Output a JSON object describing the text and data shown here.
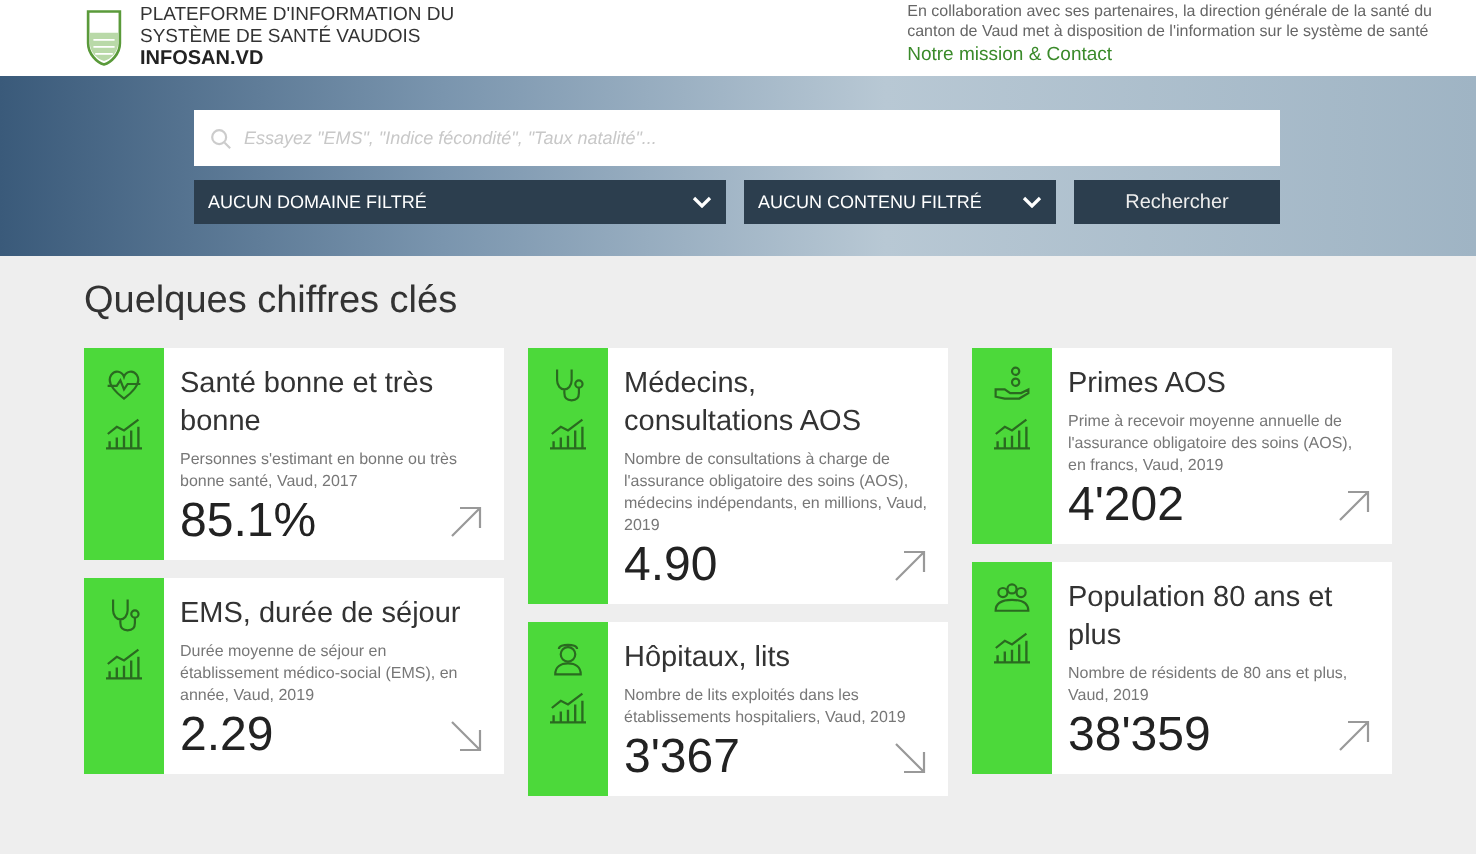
{
  "header": {
    "title_lines": [
      "PLATEFORME D'INFORMATION DU",
      "SYSTÈME DE SANTÉ VAUDOIS"
    ],
    "site_name": "INFOSAN.VD",
    "intro_lines": [
      "En collaboration avec ses partenaires, la direction générale de la santé du",
      "canton de Vaud met à disposition de l'information sur le système de santé"
    ],
    "link": "Notre mission & Contact"
  },
  "search": {
    "placeholder": "Essayez \"EMS\", \"Indice fécondité\", \"Taux natalité\"...",
    "domain_filter": "AUCUN DOMAINE FILTRÉ",
    "content_filter": "AUCUN CONTENU FILTRÉ",
    "button": "Rechercher"
  },
  "section_title": "Quelques chiffres clés",
  "columns": [
    [
      {
        "kind": "heart",
        "title": "Santé bonne et très bonne",
        "description": "Personnes s'estimant en bonne ou très bonne santé, Vaud, 2017",
        "value": "85.1%",
        "rising": true
      },
      {
        "kind": "stethoscope",
        "title": "EMS, durée de séjour",
        "description": "Durée moyenne de séjour en établissement médico-social (EMS), en année, Vaud, 2019",
        "value": "2.29",
        "rising": false
      }
    ],
    [
      {
        "kind": "stethoscope",
        "title": "Médecins, consultations AOS",
        "description": "Nombre de consultations à charge de l'assurance obligatoire des soins (AOS), médecins indépendants, en millions, Vaud, 2019",
        "value": "4.90",
        "rising": true
      },
      {
        "kind": "nurse",
        "title": "Hôpitaux, lits",
        "description": "Nombre de lits exploités dans les établissements hospitaliers, Vaud, 2019",
        "value": "3'367",
        "rising": false
      }
    ],
    [
      {
        "kind": "coins",
        "title": "Primes AOS",
        "description": "Prime à recevoir moyenne annuelle de l'assurance obligatoire des soins (AOS), en francs, Vaud, 2019",
        "value": "4'202",
        "rising": true
      },
      {
        "kind": "people",
        "title": "Population 80 ans et plus",
        "description": "Nombre de résidents de 80 ans et plus, Vaud, 2019",
        "value": "38'359",
        "rising": true
      }
    ]
  ]
}
